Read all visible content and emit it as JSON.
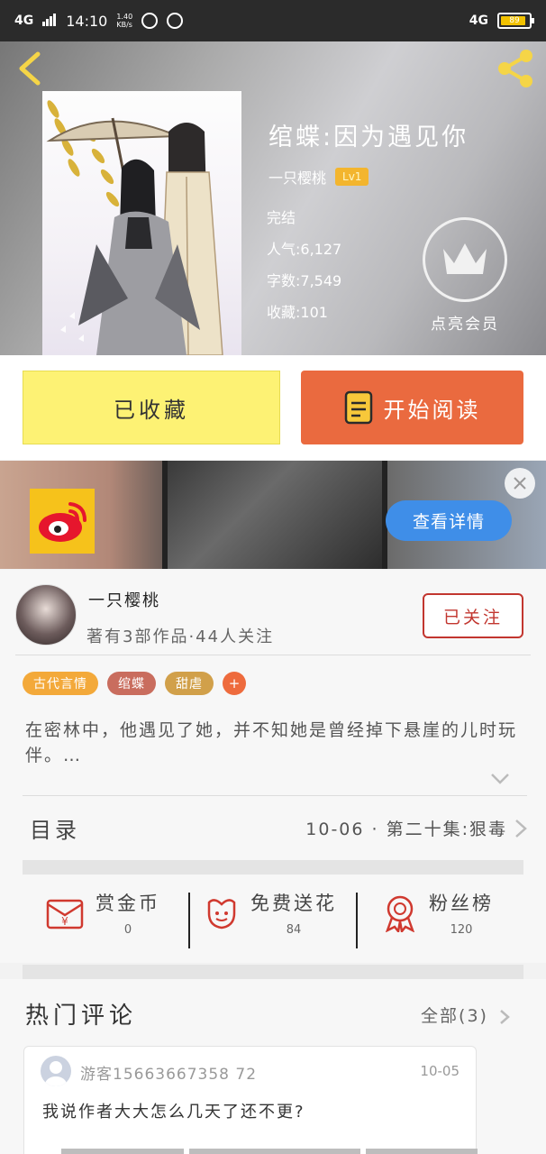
{
  "status_bar": {
    "network": "4G",
    "time": "14:10",
    "speed_value": "1.40",
    "speed_unit": "KB/s",
    "network_right": "4G",
    "battery_level": "89",
    "battery_fraction": 0.89
  },
  "header": {
    "book_title": "绾蝶:因为遇见你",
    "author": "一只樱桃",
    "author_level": "Lv1",
    "status": "完结",
    "popularity": "人气:6,127",
    "word_count": "字数:7,549",
    "favorites": "收藏:101",
    "vip_label": "点亮会员"
  },
  "actions": {
    "collect_label": "已收藏",
    "read_label": "开始阅读"
  },
  "ad": {
    "detail_label": "查看详情"
  },
  "author_card": {
    "name": "一只樱桃",
    "stats": "著有3部作品·44人关注",
    "follow_label": "已关注"
  },
  "tags": [
    {
      "label": "古代言情",
      "color": "#f3a93a"
    },
    {
      "label": "绾蝶",
      "color": "#c96d5e"
    },
    {
      "label": "甜虐",
      "color": "#d1a04a"
    }
  ],
  "tag_more": "+",
  "description": "在密林中，他遇见了她，并不知她是曾经掉下悬崖的儿时玩伴。…",
  "toc": {
    "label": "目录",
    "latest": "10-06 · 第二十集:狠毒"
  },
  "stats": [
    {
      "label": "赏金币",
      "value": "0",
      "icon": "red-envelope-icon"
    },
    {
      "label": "免费送花",
      "value": "84",
      "icon": "flower-icon"
    },
    {
      "label": "粉丝榜",
      "value": "120",
      "icon": "medal-icon"
    }
  ],
  "comments": {
    "title": "热门评论",
    "all_label": "全部(3)",
    "items": [
      {
        "user": "游客15663667358 72",
        "time": "10-05",
        "text": "我说作者大大怎么几天了还不更?"
      }
    ]
  },
  "colors": {
    "accent_orange": "#ea6a3f",
    "collect_yellow": "#fdf274",
    "follow_red": "#c2362f",
    "ad_blue": "#3f8ee8"
  }
}
